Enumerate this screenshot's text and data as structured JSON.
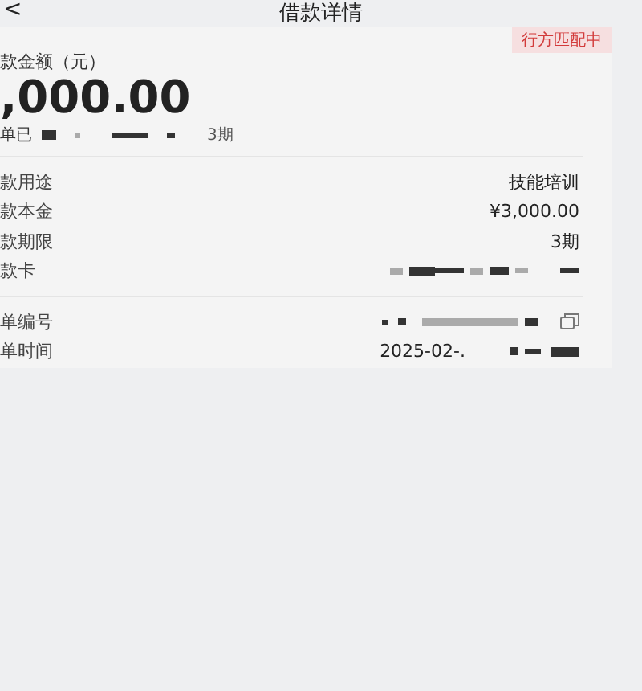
{
  "header": {
    "back": "<",
    "title": "借款详情"
  },
  "summary": {
    "badge": "行方匹配中",
    "amount_label": "款金额（元）",
    "amount": ",000.00",
    "status_prefix": "单已",
    "installments": "3期"
  },
  "details": [
    {
      "label": "款用途",
      "value": "技能培训",
      "kind": "text"
    },
    {
      "label": "款本金",
      "value": "¥3,000.00",
      "kind": "text"
    },
    {
      "label": "款期限",
      "value": "3期",
      "kind": "text"
    },
    {
      "label": "款卡",
      "kind": "redacted"
    }
  ],
  "order": [
    {
      "label": "单编号",
      "kind": "copy"
    },
    {
      "label": "单时间",
      "value": "2025-02-.",
      "kind": "partial"
    }
  ]
}
